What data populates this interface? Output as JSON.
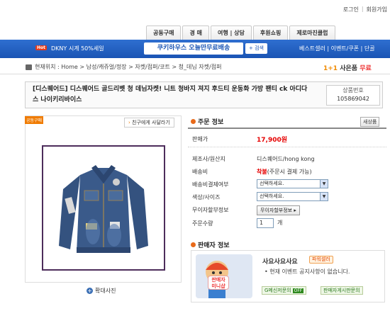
{
  "utility": {
    "login": "로그인",
    "signup": "회원가입"
  },
  "tabs": [
    "공동구매",
    "경  매",
    "여행 | 상담",
    "후원쇼핑",
    "제로마진클럽"
  ],
  "nav": {
    "hot_badge": "Hot",
    "promo_left": "DKNY 시계 50%세일",
    "promo_center": "쿠키하우스 오늘만무료배송",
    "search_label": "검색",
    "right": "베스트셀러 | 이벤트/쿠폰 | 단골"
  },
  "breadcrumb": {
    "label": "현재위치 : Home > 남성/캐쥬얼/정장 > 자켓/점퍼/코트 > 청_데님 자켓/점퍼",
    "right_prefix": "1+1",
    "right_title": "사은품",
    "right_free": "무료"
  },
  "product": {
    "title": "[디스퀘어드] 디스퀘어드 골드리벳 청 데님자켓! 니트 청바지 져지 후드티 운동화 가방 팬티 ck 아디다스 나이키리바이스",
    "number_label": "상품번호",
    "number": "105869042"
  },
  "image_panel": {
    "badge": "공동구매",
    "friend_btn": "친구에게 사달라기",
    "zoom_label": "확대사진"
  },
  "order": {
    "header": "주문 정보",
    "zoom_btn": "새상품",
    "price_label": "판매가",
    "price": "17,900원",
    "maker_label": "제조사/원산지",
    "maker": "디스퀘어드/hong kong",
    "ship_label": "배송비",
    "ship_value": "착불",
    "ship_note": "(주문시 결제 가능)",
    "pay_label": "배송비결제여부",
    "pay_select": "선택하세요.",
    "color_label": "색상/사이즈",
    "color_select": "선택하세요.",
    "nointerest_label": "무이자할부정보",
    "nointerest_btn": "무이자할부정보",
    "qty_label": "주문수량",
    "qty": "1",
    "qty_unit": "개"
  },
  "seller": {
    "header": "판매자 정보",
    "mascot_line1": "판매자",
    "mascot_line2": "미니샵",
    "name": "사요사요사요",
    "badge": "파워셀러",
    "notice": "• 현재 이벤트 공지사항이 없습니다.",
    "btn_mail": "G메신저문의",
    "btn_off": "OFF",
    "btn_board": "판매자게시판문의"
  },
  "colors": {
    "nav_blue": "#1a54b4",
    "price_red": "#e60000",
    "accent_orange": "#f07b00"
  }
}
